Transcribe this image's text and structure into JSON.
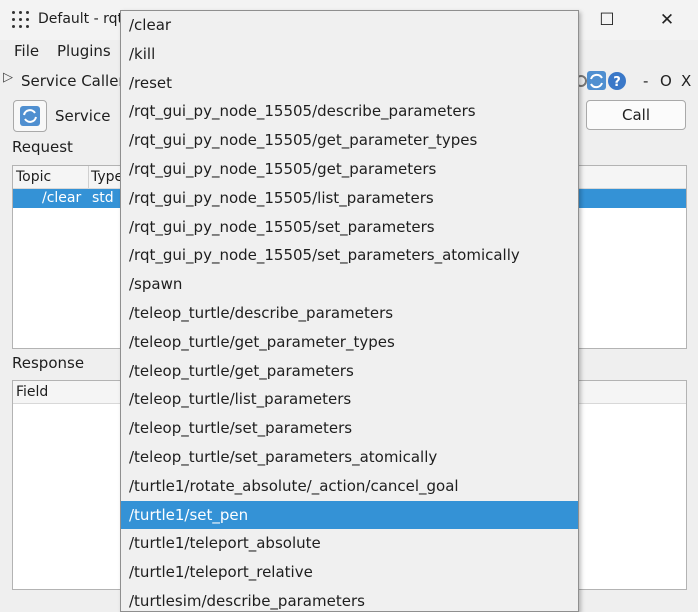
{
  "window": {
    "title": "Default - rqt",
    "minimize": "─",
    "maximize": "☐",
    "close": "✕"
  },
  "menubar": {
    "file": "File",
    "plugins": "Plugins"
  },
  "plugin_header": {
    "title": "Service Caller",
    "dash": "-",
    "o": "O",
    "x": "X"
  },
  "service_row": {
    "label": "Service",
    "call_button": "Call"
  },
  "request": {
    "label": "Request",
    "columns": [
      "Topic",
      "Type"
    ],
    "row": {
      "topic": "/clear",
      "type": "std"
    }
  },
  "response": {
    "label": "Response",
    "columns": [
      "Field"
    ]
  },
  "dropdown": {
    "selected_index": 17,
    "options": [
      "/clear",
      "/kill",
      "/reset",
      "/rqt_gui_py_node_15505/describe_parameters",
      "/rqt_gui_py_node_15505/get_parameter_types",
      "/rqt_gui_py_node_15505/get_parameters",
      "/rqt_gui_py_node_15505/list_parameters",
      "/rqt_gui_py_node_15505/set_parameters",
      "/rqt_gui_py_node_15505/set_parameters_atomically",
      "/spawn",
      "/teleop_turtle/describe_parameters",
      "/teleop_turtle/get_parameter_types",
      "/teleop_turtle/get_parameters",
      "/teleop_turtle/list_parameters",
      "/teleop_turtle/set_parameters",
      "/teleop_turtle/set_parameters_atomically",
      "/turtle1/rotate_absolute/_action/cancel_goal",
      "/turtle1/set_pen",
      "/turtle1/teleport_absolute",
      "/turtle1/teleport_relative",
      "/turtlesim/describe_parameters"
    ]
  },
  "colors": {
    "selection": "#3492d6",
    "window_bg": "#efefef"
  }
}
